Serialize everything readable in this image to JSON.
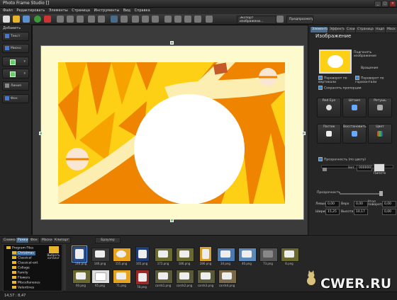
{
  "app": {
    "title": "Photo Frame Studio []"
  },
  "menu": [
    "Файл",
    "Редактировать",
    "Элементы",
    "Страница",
    "Инструменты",
    "Вид",
    "Справка"
  ],
  "toolbar": {
    "export_label": "Экспорт изображени...",
    "preview_label": "Предпросмотр"
  },
  "left_panel": {
    "header": "Добавить",
    "buttons": [
      "Текст",
      "Миско",
      "Линия",
      "Фон"
    ]
  },
  "right_panel": {
    "tabs": [
      "Элементы",
      "Эффекты",
      "Слои",
      "Страница",
      "Надп",
      "Маск"
    ],
    "section_title": "Изображение",
    "fit_label": "Подгонять изображение",
    "rotate_label": "Вращение",
    "flip_v": "Переворот по вертикали",
    "flip_h": "Переворот по горизонтали",
    "keep_ratio": "Сохранять пропорции",
    "actions": [
      "Red Eye",
      "Штамп",
      "Ретушь",
      "Ластик",
      "Восстановить",
      "Цвет"
    ],
    "transparency_label": "Прозрачность (по цвету)",
    "transparency_value": "000000",
    "transparency_prefix": "Нет",
    "pipette_label": "Пипетк",
    "opacity_label": "Прозрачность",
    "fields": {
      "left_label": "Левый",
      "left": "0,00",
      "top_label": "Верх",
      "top": "0,00",
      "right_label": "Угол поворота",
      "right": "0,00",
      "width_label": "Ширина",
      "width": "15,25",
      "height_label": "Высота",
      "height": "10,17"
    }
  },
  "bottom": {
    "tabs": [
      "Снимки",
      "Рамки",
      "Фон",
      "Маски",
      "Клипарт"
    ],
    "browse_button": "Браузер",
    "tree": [
      "Program Files",
      "Christmas",
      "Classical",
      "Classical-ext",
      "Collage",
      "Family",
      "Flowers",
      "Miscellaneous",
      "Valentines"
    ],
    "tree_selected": "Christmas",
    "folder_label": "Выбрать каталог",
    "thumbs_row1": [
      "144.png",
      "146.png",
      "155.png",
      "165.png",
      "172.png",
      "186.png",
      "286.png",
      "34.png",
      "40.png",
      "73.png",
      "8.png"
    ],
    "thumbs_row2": [
      "60.png",
      "65.png",
      "71.png",
      "78.png",
      "cards1.png",
      "cards2.png",
      "cards3.png",
      "cards4.png"
    ]
  },
  "status": {
    "coords": "14,57 : 8,47"
  },
  "watermark": {
    "text": "CWER.RU"
  },
  "colors": {
    "accent": "#4a6b8a",
    "frame_orange": "#ee8400",
    "frame_yellow": "#fdd016",
    "canvas_bg": "#fdfbcd"
  }
}
